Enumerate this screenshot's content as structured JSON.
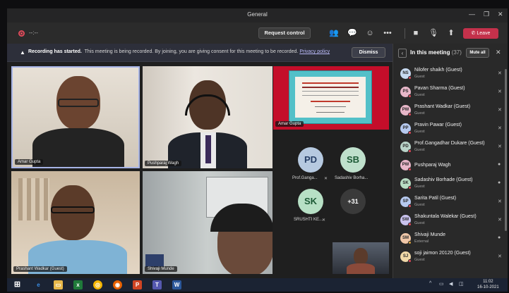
{
  "window": {
    "title": "General"
  },
  "toolbar": {
    "timer": "--:--",
    "request_control": "Request control",
    "leave": "Leave",
    "leave_color": "#c4314b"
  },
  "banner": {
    "heading": "Recording has started.",
    "message": "This meeting is being recorded. By joining, you are giving consent for this meeting to be recorded.",
    "link": "Privacy policy",
    "dismiss": "Dismiss"
  },
  "stage": {
    "tiles": [
      {
        "name": "Amar Gupta"
      },
      {
        "name": "Pushparaj Wagh"
      },
      {
        "name": "Prashant Wadkar (Guest)"
      },
      {
        "name": "Shivaji Munde"
      },
      {
        "name": "Amar Gupta"
      }
    ],
    "avatars": [
      {
        "initials": "PD",
        "label": "Prof.Ganga..."
      },
      {
        "initials": "SB",
        "label": "Sadashiv Borha..."
      },
      {
        "initials": "SK",
        "label": "SRUSHTI KE..."
      }
    ],
    "overflow": "+31"
  },
  "panel": {
    "title": "In this meeting",
    "count": "(37)",
    "mute_all": "Mute all",
    "participants": [
      {
        "initials": "NS",
        "name": "Nilofer shaikh (Guest)",
        "role": "Guest",
        "color": "#c7d9f0",
        "muted": true
      },
      {
        "initials": "PS",
        "name": "Pavan Sharma (Guest)",
        "role": "Guest",
        "color": "#e8b7c9",
        "muted": true
      },
      {
        "initials": "PW",
        "name": "Prashant Wadkar (Guest)",
        "role": "Guest",
        "color": "#e8b7c9",
        "muted": true
      },
      {
        "initials": "PP",
        "name": "Pravin Pawar (Guest)",
        "role": "Guest",
        "color": "#b6c9ef",
        "muted": true
      },
      {
        "initials": "PD",
        "name": "Prof.Gangadhar Dukare (Guest)",
        "role": "Guest",
        "color": "#b9d4c9",
        "muted": true
      },
      {
        "initials": "PW",
        "name": "Pushparaj Wagh",
        "role": "",
        "color": "#e8b7c9",
        "muted": false
      },
      {
        "initials": "SK",
        "name": "Sadashiv Borhade (Guest)",
        "role": "Guest",
        "color": "#b9dcc4",
        "muted": false
      },
      {
        "initials": "SP",
        "name": "Sarita Patil (Guest)",
        "role": "Guest",
        "color": "#b6c9ef",
        "muted": true
      },
      {
        "initials": "SW",
        "name": "Shakuntala Walekar (Guest)",
        "role": "Guest",
        "color": "#c9c2ee",
        "muted": true
      },
      {
        "initials": "SM",
        "name": "Shivaji Munde",
        "role": "External",
        "color": "#f0c7a8",
        "muted": false
      },
      {
        "initials": "SJ",
        "name": "soji jaimon 20120 (Guest)",
        "role": "Guest",
        "color": "#f0d9a8",
        "muted": true
      }
    ]
  },
  "taskbar": {
    "time": "11:02",
    "date": "16-10-2021"
  }
}
